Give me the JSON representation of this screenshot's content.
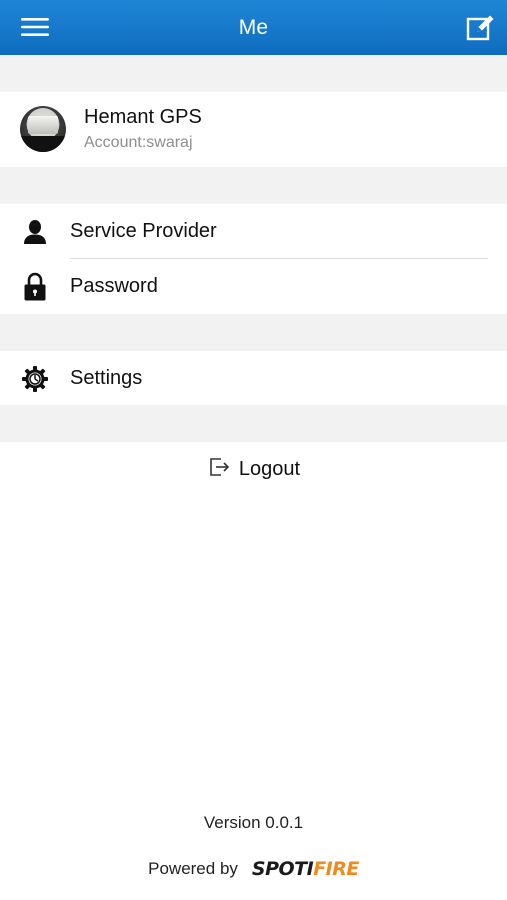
{
  "header": {
    "title": "Me",
    "menu_icon": "hamburger-menu-icon",
    "edit_icon": "edit-icon",
    "background": "#1677cc"
  },
  "profile": {
    "name": "Hemant GPS",
    "account": "Account:swaraj"
  },
  "menu": {
    "service_provider": {
      "label": "Service Provider",
      "icon": "person-icon"
    },
    "password": {
      "label": "Password",
      "icon": "lock-icon"
    },
    "settings": {
      "label": "Settings",
      "icon": "gear-icon"
    }
  },
  "logout": {
    "label": "Logout",
    "icon": "logout-icon"
  },
  "footer": {
    "version": "Version 0.0.1",
    "powered_by": "Powered by",
    "brand_part1": "SPOTI",
    "brand_part2": "FIRE",
    "brand_accent": "#f08a1c"
  }
}
